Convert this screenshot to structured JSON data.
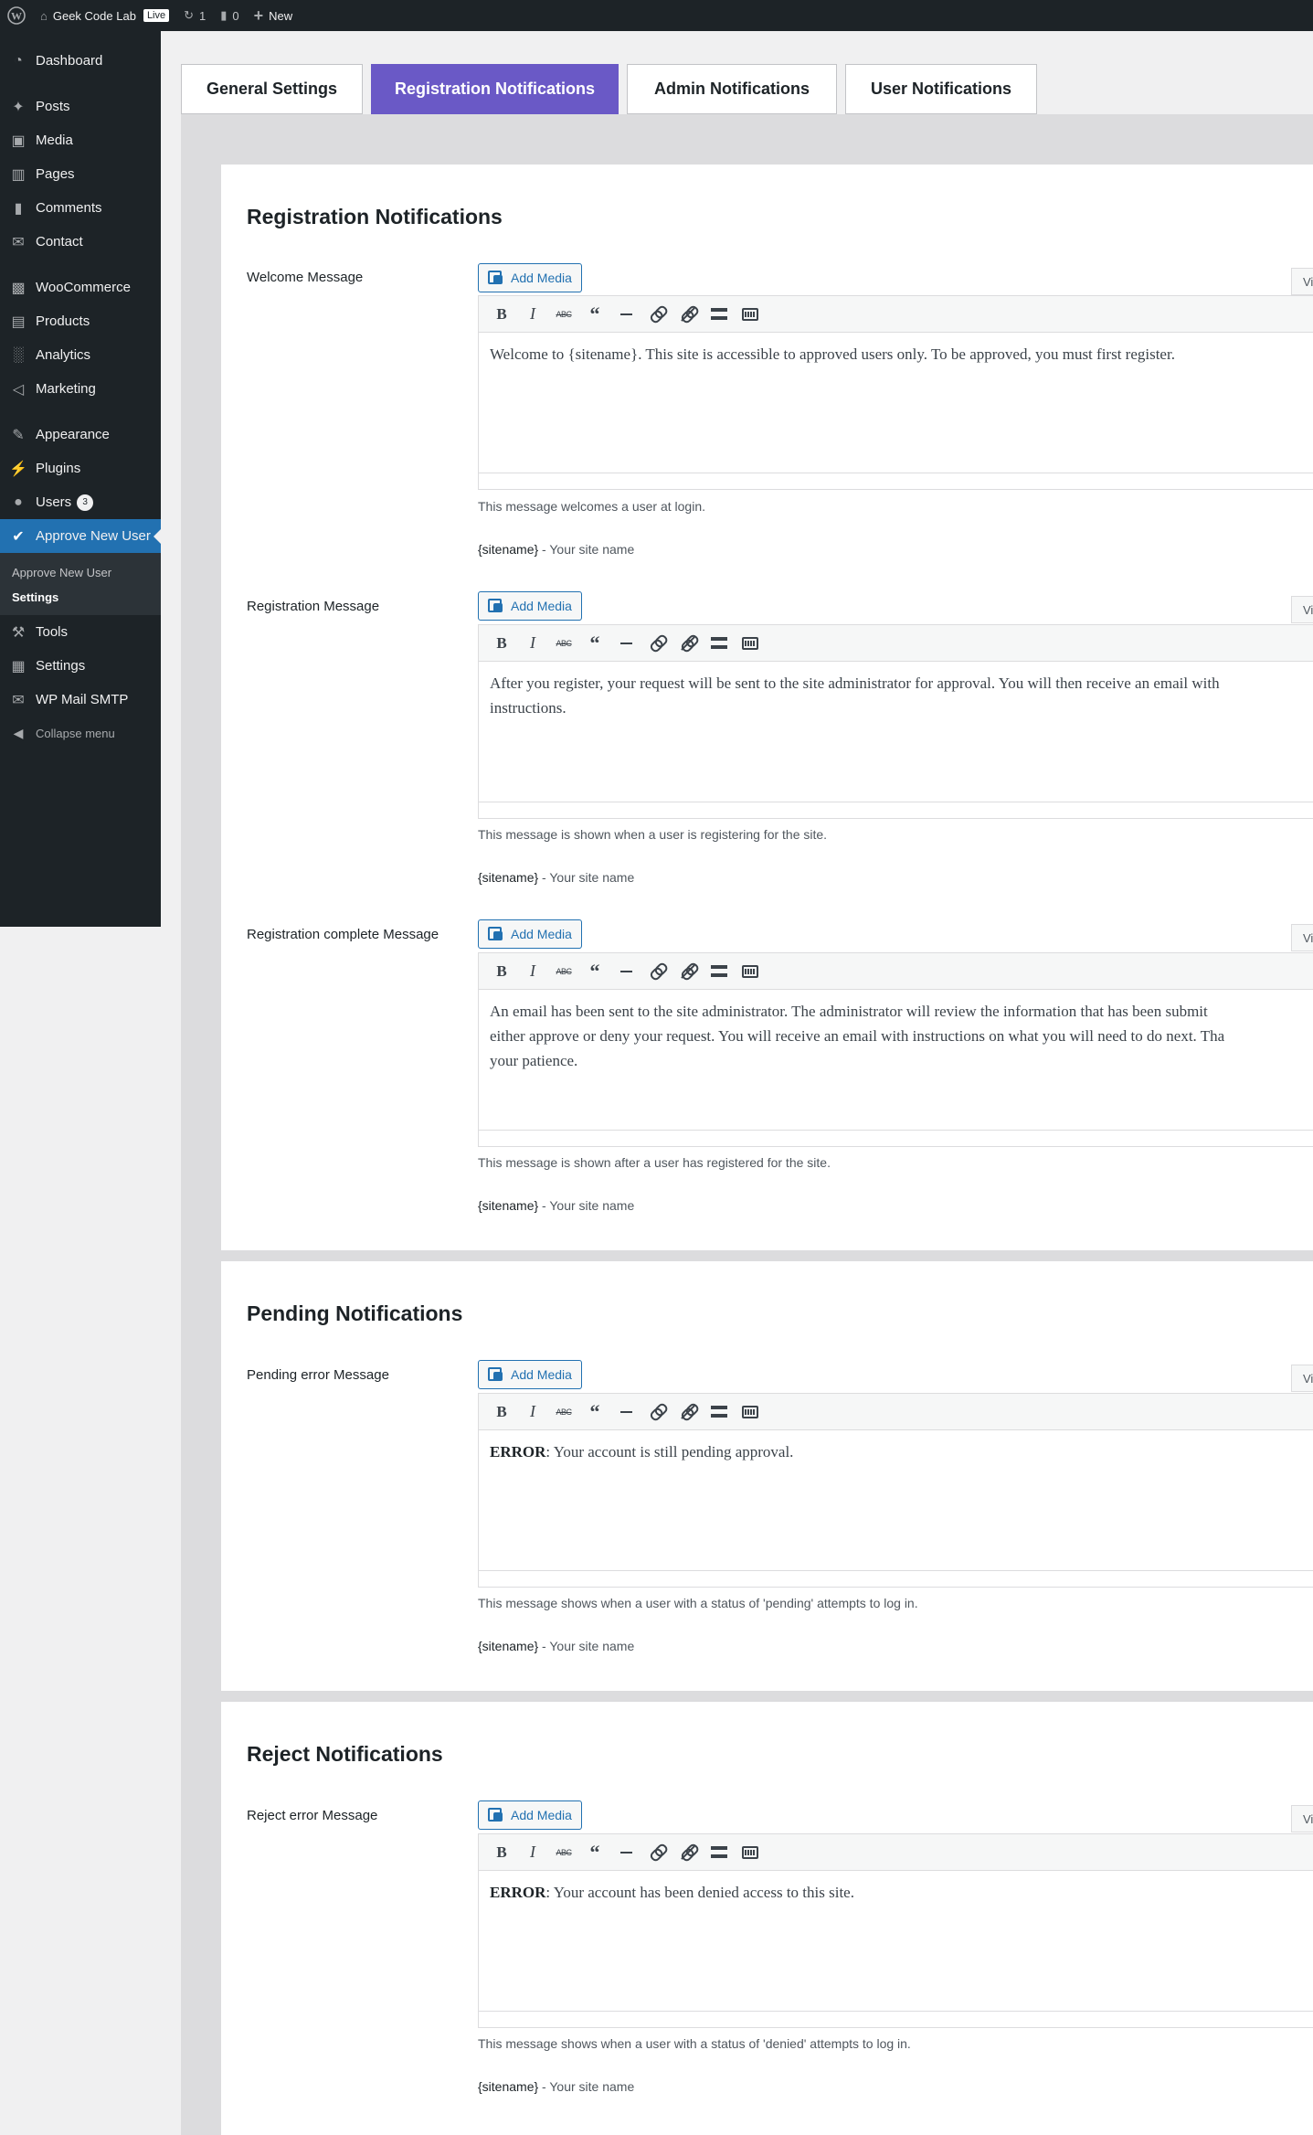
{
  "adminbar": {
    "site_name": "Geek Code Lab",
    "live_badge": "Live",
    "updates_count": "1",
    "comments_count": "0",
    "new_label": "New"
  },
  "sidebar": {
    "items": [
      {
        "label": "Dashboard",
        "icon": "dashboard-icon"
      },
      {
        "label": "Posts",
        "icon": "pin-icon"
      },
      {
        "label": "Media",
        "icon": "media-icon"
      },
      {
        "label": "Pages",
        "icon": "page-icon"
      },
      {
        "label": "Comments",
        "icon": "comment-icon"
      },
      {
        "label": "Contact",
        "icon": "mail-icon"
      },
      {
        "label": "WooCommerce",
        "icon": "woo-icon"
      },
      {
        "label": "Products",
        "icon": "archive-icon"
      },
      {
        "label": "Analytics",
        "icon": "chart-icon"
      },
      {
        "label": "Marketing",
        "icon": "megaphone-icon"
      },
      {
        "label": "Appearance",
        "icon": "brush-icon"
      },
      {
        "label": "Plugins",
        "icon": "plugin-icon"
      },
      {
        "label": "Users",
        "icon": "user-icon",
        "badge": "3"
      },
      {
        "label": "Approve New User",
        "icon": "check-circle-icon"
      },
      {
        "label": "Tools",
        "icon": "wrench-icon"
      },
      {
        "label": "Settings",
        "icon": "settings-icon"
      },
      {
        "label": "WP Mail SMTP",
        "icon": "envelope-icon"
      },
      {
        "label": "Collapse menu",
        "icon": "collapse-icon"
      }
    ],
    "submenu": [
      "Approve New User",
      "Settings"
    ]
  },
  "tabs": [
    {
      "label": "General Settings",
      "active": false
    },
    {
      "label": "Registration Notifications",
      "active": true
    },
    {
      "label": "Admin Notifications",
      "active": false
    },
    {
      "label": "User Notifications",
      "active": false
    }
  ],
  "sections": [
    {
      "title": "Registration Notifications",
      "fields": [
        {
          "label": "Welcome Message",
          "content": [
            "Welcome to {sitename}. This site is accessible to approved users only. To be approved, you must first register."
          ],
          "help": "This message welcomes a user at login.",
          "tag": "{sitename}",
          "tag_desc": " - Your site name"
        },
        {
          "label": "Registration Message",
          "content": [
            "After you register, your request will be sent to the site administrator for approval. You will then receive an email with",
            "instructions."
          ],
          "help": "This message is shown when a user is registering for the site.",
          "tag": "{sitename}",
          "tag_desc": " - Your site name"
        },
        {
          "label": "Registration complete Message",
          "content": [
            "An email has been sent to the site administrator. The administrator will review the information that has been submit",
            "either approve or deny your request. You will receive an email with instructions on what you will need to do next. Tha",
            "your patience."
          ],
          "help": "This message is shown after a user has registered for the site.",
          "tag": "{sitename}",
          "tag_desc": " - Your site name"
        }
      ]
    },
    {
      "title": "Pending Notifications",
      "fields": [
        {
          "label": "Pending error Message",
          "content_strong": "ERROR",
          "content_rest": ": Your account is still pending approval.",
          "help": "This message shows when a user with a status of 'pending' attempts to log in.",
          "tag": "{sitename}",
          "tag_desc": " - Your site name"
        }
      ]
    },
    {
      "title": "Reject Notifications",
      "fields": [
        {
          "label": "Reject error Message",
          "content_strong": "ERROR",
          "content_rest": ": Your account has been denied access to this site.",
          "help": "This message shows when a user with a status of 'denied' attempts to log in.",
          "tag": "{sitename}",
          "tag_desc": " - Your site name"
        }
      ]
    }
  ],
  "editor": {
    "add_media_label": "Add Media",
    "visual_tab": "Vi"
  },
  "colors": {
    "active_tab": "#6a59c6",
    "admin_blue": "#2271b1",
    "sidebar_bg": "#1d2327"
  }
}
